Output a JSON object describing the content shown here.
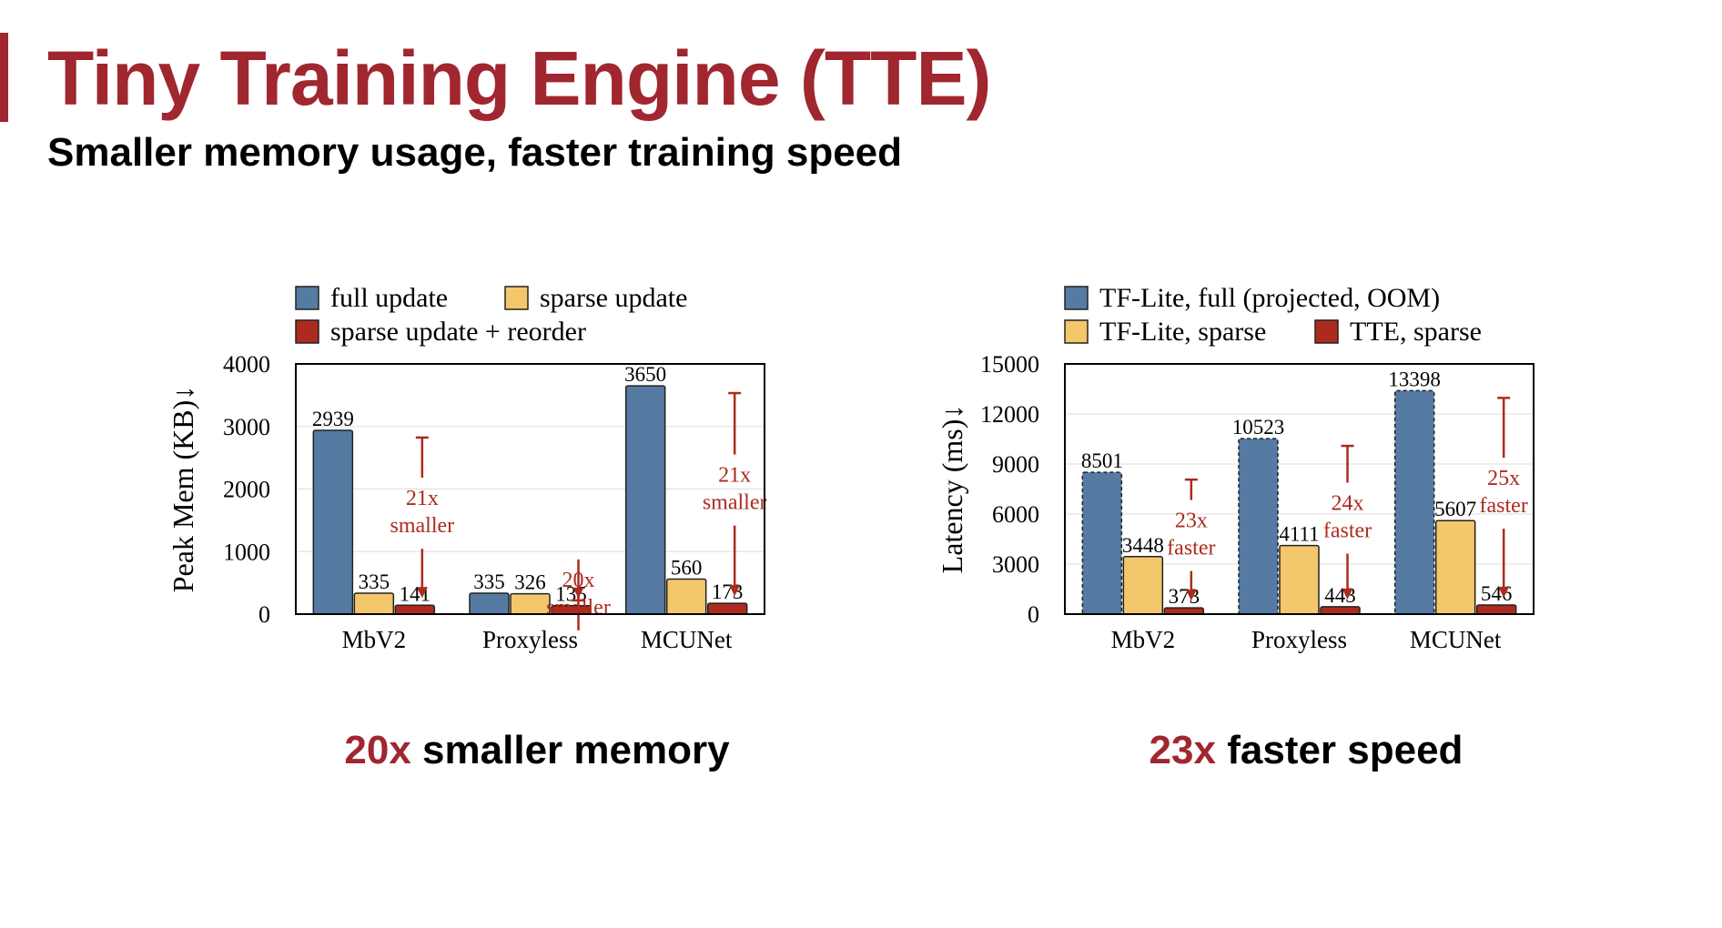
{
  "slide": {
    "title": "Tiny Training Engine (TTE)",
    "subtitle": "Smaller memory usage, faster training speed",
    "title_color": "#a0262f",
    "captions": [
      {
        "emph": "20x",
        "rest": " smaller memory"
      },
      {
        "emph": "23x",
        "rest": " faster speed"
      }
    ]
  },
  "chart_data": [
    {
      "type": "bar",
      "categories": [
        "MbV2",
        "Proxyless",
        "MCUNet"
      ],
      "ylabel": "Peak Mem (KB)↓",
      "ylim": [
        0,
        4000
      ],
      "yticks": [
        0,
        1000,
        2000,
        3000,
        4000
      ],
      "grid": true,
      "legend_position": "top",
      "series": [
        {
          "name": "full update",
          "values": [
            2939,
            335,
            3650
          ],
          "color": "#557ba3",
          "dashed": false
        },
        {
          "name": "sparse update",
          "values": [
            335,
            326,
            560
          ],
          "color": "#f4c76c",
          "dashed": false
        },
        {
          "name": "sparse update + reorder",
          "values": [
            141,
            135,
            173
          ],
          "color": "#ac2b1e",
          "dashed": false
        }
      ],
      "annotations": [
        {
          "category": "MbV2",
          "lines": [
            "21x",
            "smaller"
          ]
        },
        {
          "category": "Proxyless",
          "lines": [
            "20x",
            "smaller"
          ]
        },
        {
          "category": "MCUNet",
          "lines": [
            "21x",
            "smaller"
          ]
        }
      ]
    },
    {
      "type": "bar",
      "categories": [
        "MbV2",
        "Proxyless",
        "MCUNet"
      ],
      "ylabel": "Latency (ms)↓",
      "ylim": [
        0,
        15000
      ],
      "yticks": [
        0,
        3000,
        6000,
        9000,
        12000,
        15000
      ],
      "grid": true,
      "legend_position": "top",
      "series": [
        {
          "name": "TF-Lite, full (projected, OOM)",
          "values": [
            8501,
            10523,
            13398
          ],
          "color": "#557ba3",
          "dashed": true
        },
        {
          "name": "TF-Lite, sparse",
          "values": [
            3448,
            4111,
            5607
          ],
          "color": "#f4c76c",
          "dashed": false
        },
        {
          "name": "TTE, sparse",
          "values": [
            373,
            443,
            546
          ],
          "color": "#ac2b1e",
          "dashed": false
        }
      ],
      "annotations": [
        {
          "category": "MbV2",
          "lines": [
            "23x",
            "faster"
          ]
        },
        {
          "category": "Proxyless",
          "lines": [
            "24x",
            "faster"
          ]
        },
        {
          "category": "MCUNet",
          "lines": [
            "25x",
            "faster"
          ]
        }
      ]
    }
  ]
}
